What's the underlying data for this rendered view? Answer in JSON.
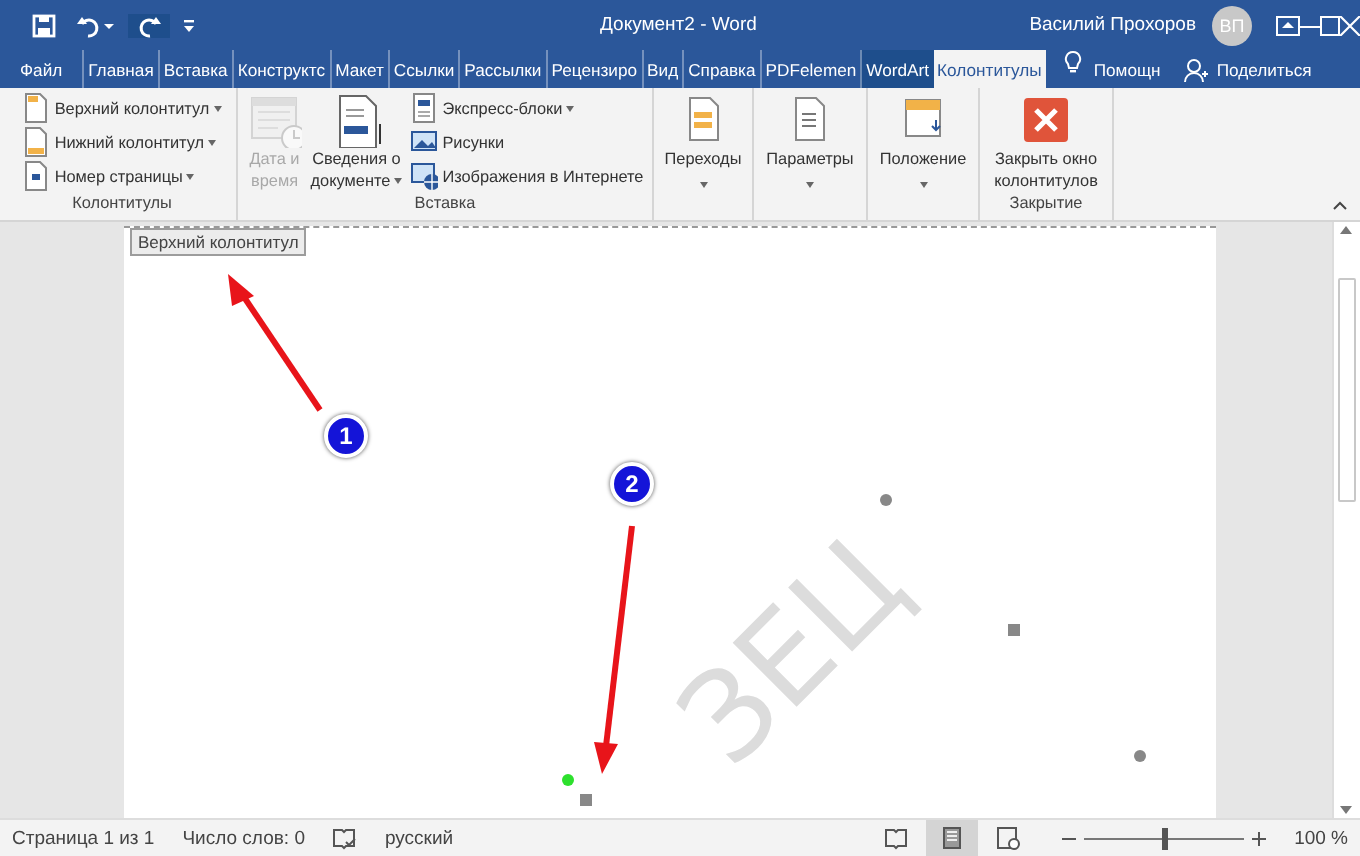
{
  "title_bar": {
    "title": "Документ2 - Word",
    "user": "Василий Прохоров",
    "avatar_initials": "ВП"
  },
  "tabs": [
    {
      "label": "Файл",
      "kind": "file",
      "selected": false
    },
    {
      "label": "Главная",
      "kind": "standard",
      "selected": false
    },
    {
      "label": "Вставка",
      "kind": "standard",
      "selected": false
    },
    {
      "label": "Конструктс",
      "kind": "standard",
      "selected": false
    },
    {
      "label": "Макет",
      "kind": "standard",
      "selected": false
    },
    {
      "label": "Ссылки",
      "kind": "standard",
      "selected": false
    },
    {
      "label": "Рассылки",
      "kind": "standard",
      "selected": false
    },
    {
      "label": "Рецензиро",
      "kind": "standard",
      "selected": false
    },
    {
      "label": "Вид",
      "kind": "standard",
      "selected": false
    },
    {
      "label": "Справка",
      "kind": "standard",
      "selected": false
    },
    {
      "label": "PDFelemen",
      "kind": "standard",
      "selected": false
    },
    {
      "label": "WordArt",
      "kind": "contextual",
      "selected": false
    },
    {
      "label": "Колонтитулы",
      "kind": "contextual",
      "selected": true
    }
  ],
  "tell_me": "Помощн",
  "share": "Поделиться",
  "ribbon_groups": [
    {
      "label": "Колонтитулы",
      "items": [
        {
          "kind": "small",
          "label": "Верхний колонтитул",
          "dropdown": true,
          "disabled": false
        },
        {
          "kind": "small",
          "label": "Нижний колонтитул",
          "dropdown": true,
          "disabled": false
        },
        {
          "kind": "small",
          "label": "Номер страницы",
          "dropdown": true,
          "disabled": false
        }
      ]
    },
    {
      "label": "Вставка",
      "items": [
        {
          "kind": "large",
          "lines": [
            "Дата и",
            "время"
          ],
          "dropdown": false,
          "disabled": true
        },
        {
          "kind": "large",
          "lines": [
            "Сведения о",
            "документе"
          ],
          "dropdown": true,
          "disabled": false
        },
        {
          "kind": "small",
          "label": "Экспресс-блоки",
          "dropdown": true,
          "disabled": false
        },
        {
          "kind": "small",
          "label": "Рисунки",
          "dropdown": false,
          "disabled": false
        },
        {
          "kind": "small",
          "label": "Изображения в Интернете",
          "dropdown": false,
          "disabled": false
        }
      ]
    },
    {
      "items": [
        {
          "kind": "large",
          "lines": [
            "Переходы"
          ],
          "dropdown": true,
          "disabled": false
        }
      ]
    },
    {
      "items": [
        {
          "kind": "large",
          "lines": [
            "Параметры"
          ],
          "dropdown": true,
          "disabled": false
        }
      ]
    },
    {
      "items": [
        {
          "kind": "large",
          "lines": [
            "Положение"
          ],
          "dropdown": true,
          "disabled": false
        }
      ]
    },
    {
      "label": "Закрытие",
      "items": [
        {
          "kind": "large",
          "lines": [
            "Закрыть окно",
            "колонтитулов"
          ],
          "dropdown": false,
          "disabled": false
        }
      ]
    }
  ],
  "document": {
    "header_tag": "Верхний колонтитул",
    "wordart_text": "ЗЕЦ"
  },
  "annotations": [
    {
      "number": "1"
    },
    {
      "number": "2"
    }
  ],
  "status_bar": {
    "page": "Страница 1 из 1",
    "words": "Число слов: 0",
    "language": "русский",
    "views": [
      {
        "selected": false
      },
      {
        "selected": true
      },
      {
        "selected": false
      }
    ],
    "zoom": {
      "level": 0.5,
      "reading": "100 %"
    }
  }
}
